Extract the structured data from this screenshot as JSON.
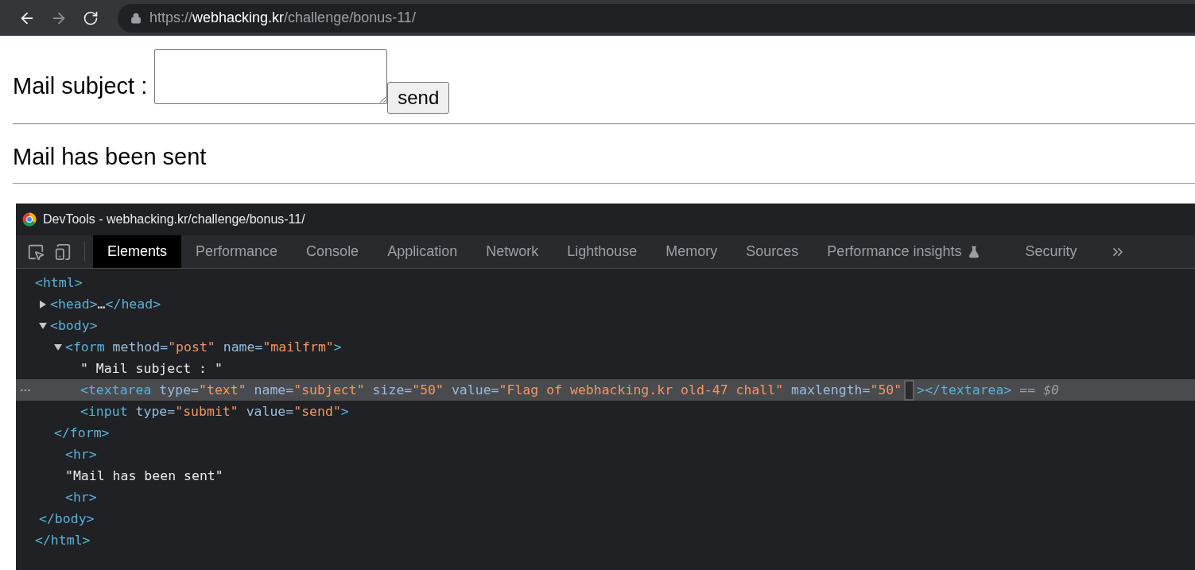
{
  "browser": {
    "url_scheme": "https://",
    "url_host": "webhacking.kr",
    "url_path": "/challenge/bonus-11/",
    "forward_disabled": true
  },
  "page": {
    "label": "Mail subject :",
    "button": "send",
    "message": "Mail has been sent"
  },
  "devtools": {
    "title": "DevTools - webhacking.kr/challenge/bonus-11/",
    "tabs": [
      {
        "label": "Elements",
        "selected": true,
        "experimental": false
      },
      {
        "label": "Performance",
        "selected": false,
        "experimental": false
      },
      {
        "label": "Console",
        "selected": false,
        "experimental": false
      },
      {
        "label": "Application",
        "selected": false,
        "experimental": false
      },
      {
        "label": "Network",
        "selected": false,
        "experimental": false
      },
      {
        "label": "Lighthouse",
        "selected": false,
        "experimental": false
      },
      {
        "label": "Memory",
        "selected": false,
        "experimental": false
      },
      {
        "label": "Sources",
        "selected": false,
        "experimental": false
      },
      {
        "label": "Performance insights",
        "selected": false,
        "experimental": true
      },
      {
        "label": "Security",
        "selected": false,
        "experimental": false
      }
    ],
    "tree": [
      {
        "selected": false,
        "tokens": [
          {
            "kind": "tag",
            "text": "<html>"
          }
        ],
        "close": [
          {
            "kind": "tag",
            "text": "</html>"
          }
        ],
        "children": [
          {
            "selected": false,
            "expanded": false,
            "tokens": [
              {
                "kind": "tag",
                "text": "<head>"
              },
              {
                "kind": "text",
                "text": "…"
              },
              {
                "kind": "tag",
                "text": "</head>"
              }
            ]
          },
          {
            "selected": false,
            "expanded": true,
            "tokens": [
              {
                "kind": "tag",
                "text": "<body>"
              }
            ],
            "close": [
              {
                "kind": "tag",
                "text": "</body>"
              }
            ],
            "children": [
              {
                "selected": false,
                "expanded": true,
                "tokens": [
                  {
                    "kind": "tag",
                    "text": "<form "
                  },
                  {
                    "kind": "attr",
                    "text": "method="
                  },
                  {
                    "kind": "value",
                    "text": "\"post\""
                  },
                  {
                    "kind": "attr",
                    "text": " name="
                  },
                  {
                    "kind": "value",
                    "text": "\"mailfrm\""
                  },
                  {
                    "kind": "tag",
                    "text": ">"
                  }
                ],
                "close": [
                  {
                    "kind": "tag",
                    "text": "</form>"
                  }
                ],
                "children": [
                  {
                    "selected": false,
                    "tokens": [
                      {
                        "kind": "text",
                        "text": "\" Mail subject : \""
                      }
                    ]
                  },
                  {
                    "selected": true,
                    "tokens": [
                      {
                        "kind": "tag",
                        "text": "<textarea "
                      },
                      {
                        "kind": "attr",
                        "text": "type="
                      },
                      {
                        "kind": "value",
                        "text": "\"text\""
                      },
                      {
                        "kind": "attr",
                        "text": " name="
                      },
                      {
                        "kind": "value",
                        "text": "\"subject\""
                      },
                      {
                        "kind": "attr",
                        "text": " size="
                      },
                      {
                        "kind": "value",
                        "text": "\"50\""
                      },
                      {
                        "kind": "attr",
                        "text": " value="
                      },
                      {
                        "kind": "value",
                        "text": "\"Flag of webhacking.kr old-47 chall\""
                      },
                      {
                        "kind": "attr",
                        "text": " maxlength="
                      },
                      {
                        "kind": "value",
                        "text": "\"50\""
                      },
                      {
                        "kind": "cursor"
                      },
                      {
                        "kind": "tag",
                        "text": "></textarea>"
                      },
                      {
                        "kind": "marker",
                        "text": " == "
                      },
                      {
                        "kind": "var",
                        "text": "$0"
                      }
                    ]
                  },
                  {
                    "selected": false,
                    "tokens": [
                      {
                        "kind": "tag",
                        "text": "<input "
                      },
                      {
                        "kind": "attr",
                        "text": "type="
                      },
                      {
                        "kind": "value",
                        "text": "\"submit\""
                      },
                      {
                        "kind": "attr",
                        "text": " value="
                      },
                      {
                        "kind": "value",
                        "text": "\"send\""
                      },
                      {
                        "kind": "tag",
                        "text": ">"
                      }
                    ]
                  }
                ]
              },
              {
                "selected": false,
                "tokens": [
                  {
                    "kind": "tag",
                    "text": "<hr>"
                  }
                ]
              },
              {
                "selected": false,
                "tokens": [
                  {
                    "kind": "text",
                    "text": "\"Mail has been sent\""
                  }
                ]
              },
              {
                "selected": false,
                "tokens": [
                  {
                    "kind": "tag",
                    "text": "<hr>"
                  }
                ]
              }
            ]
          }
        ]
      }
    ]
  }
}
